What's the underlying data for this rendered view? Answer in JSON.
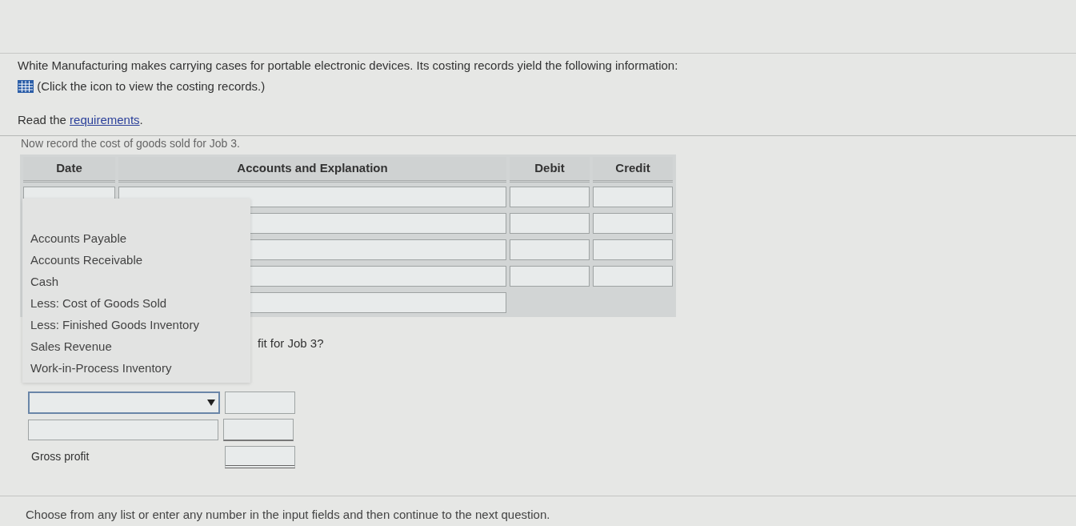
{
  "intro": "White Manufacturing makes carrying cases for portable electronic devices. Its costing records yield the following information:",
  "icon_note": "(Click the icon to view the costing records.)",
  "read_prefix": "Read the",
  "requirements_link": "requirements",
  "read_suffix": ".",
  "instruction": "Now record the cost of goods sold for Job 3.",
  "table": {
    "columns": [
      "Date",
      "Accounts and Explanation",
      "Debit",
      "Credit"
    ],
    "rows": [
      {
        "kind": "dated"
      },
      {
        "kind": "entry"
      },
      {
        "kind": "entry"
      },
      {
        "kind": "entry"
      },
      {
        "kind": "account"
      }
    ]
  },
  "question": "fit for Job 3?",
  "statement": {
    "rows": [
      {
        "kind": "select",
        "expanded": true,
        "options": [
          {
            "label": "Accounts Payable",
            "selected": false
          },
          {
            "label": "Accounts Receivable",
            "selected": false
          },
          {
            "label": "Cash",
            "selected": false
          },
          {
            "label": "Less: Cost of Goods Sold",
            "selected": false
          },
          {
            "label": "Less: Finished Goods Inventory",
            "selected": false
          },
          {
            "label": "Sales Revenue",
            "selected": false
          },
          {
            "label": "Work-in-Process Inventory",
            "selected": false
          }
        ]
      },
      {
        "kind": "field"
      },
      {
        "kind": "total",
        "label": "Gross profit"
      }
    ]
  },
  "footer": "Choose from any list or enter any number in the input fields and then continue to the next question."
}
